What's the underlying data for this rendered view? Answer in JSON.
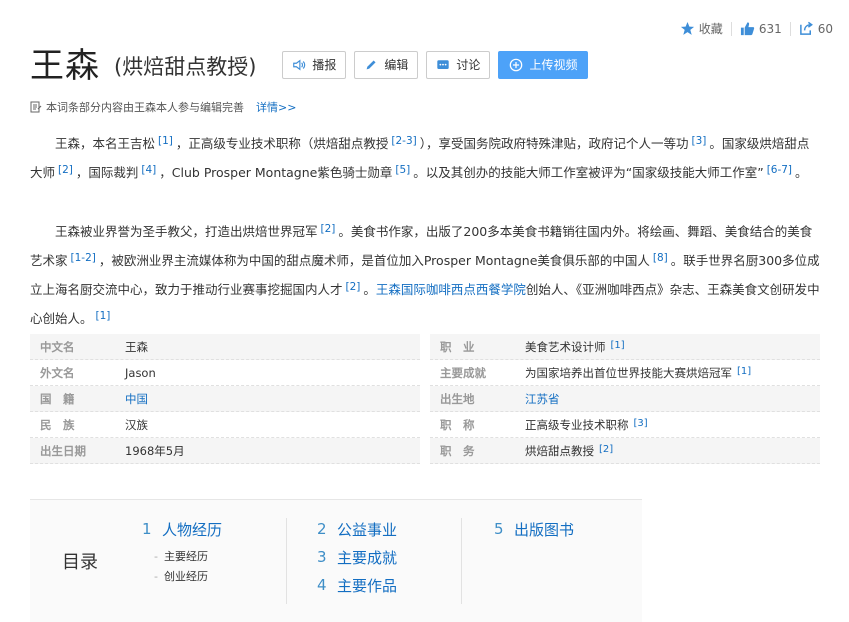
{
  "actions": {
    "favorite_label": "收藏",
    "like_count": "631",
    "share_count": "60"
  },
  "title": {
    "main": "王森",
    "sub": "(烘焙甜点教授)"
  },
  "buttons": {
    "broadcast": "播报",
    "edit": "编辑",
    "discuss": "讨论",
    "upload_video": "上传视频"
  },
  "notice": {
    "text": "本词条部分内容由王森本人参与编辑完善",
    "detail": "详情>>"
  },
  "summary": {
    "p1": [
      {
        "t": "王森，本名王吉松"
      },
      {
        "s": "[1]"
      },
      {
        "t": "，正高级专业技术职称（烘焙甜点教授"
      },
      {
        "s": "[2-3]"
      },
      {
        "t": "），享受国务院政府特殊津贴，政府记个人一等功"
      },
      {
        "s": "[3]"
      },
      {
        "t": "。国家级烘焙甜点大师"
      },
      {
        "s": "[2]"
      },
      {
        "t": "，国际裁判"
      },
      {
        "s": "[4]"
      },
      {
        "t": "，Club Prosper Montagne紫色骑士勋章"
      },
      {
        "s": "[5]"
      },
      {
        "t": "。以及其创办的技能大师工作室被评为“国家级技能大师工作室”"
      },
      {
        "s": "[6-7]"
      },
      {
        "t": "。"
      }
    ],
    "p2": [
      {
        "t": "王森被业界誉为圣手教父，打造出烘焙世界冠军"
      },
      {
        "s": "[2]"
      },
      {
        "t": "。美食书作家，出版了200多本美食书籍销往国内外。将绘画、舞蹈、美食结合的美食艺术家"
      },
      {
        "s": "[1-2]"
      },
      {
        "t": "，被欧洲业界主流媒体称为中国的甜点魔术师，是首位加入Prosper Montagne美食俱乐部的中国人"
      },
      {
        "s": "[8]"
      },
      {
        "t": "。联手世界名厨300多位成立上海名厨交流中心，致力于推动行业赛事挖掘国内人才"
      },
      {
        "s": "[2]"
      },
      {
        "t": "。"
      },
      {
        "l": "王森国际咖啡西点西餐学院"
      },
      {
        "t": "创始人、《亚洲咖啡西点》杂志、王森美食文创研发中心创始人。"
      },
      {
        "s": "[1]"
      }
    ]
  },
  "basic_info": {
    "left": [
      {
        "k": "中文名",
        "v": "王森"
      },
      {
        "k": "外文名",
        "v": "Jason"
      },
      {
        "k": "国　籍",
        "v": "中国",
        "link": true
      },
      {
        "k": "民　族",
        "v": "汉族"
      },
      {
        "k": "出生日期",
        "v": "1968年5月"
      }
    ],
    "right": [
      {
        "k": "职　业",
        "v": "美食艺术设计师",
        "ref": "[1]"
      },
      {
        "k": "主要成就",
        "v": "为国家培养出首位世界技能大赛烘焙冠军",
        "ref": "[1]"
      },
      {
        "k": "出生地",
        "v": "江苏省",
        "link": true
      },
      {
        "k": "职　称",
        "v": "正高级专业技术职称",
        "ref": "[3]"
      },
      {
        "k": "职　务",
        "v": "烘焙甜点教授",
        "ref": "[2]"
      }
    ]
  },
  "toc": {
    "title": "目录",
    "s1_num": "1",
    "s1": "人物经历",
    "s1_sub1": "主要经历",
    "s1_sub2": "创业经历",
    "s2_num": "2",
    "s2": "公益事业",
    "s3_num": "3",
    "s3": "主要成就",
    "s4_num": "4",
    "s4": "主要作品",
    "s5_num": "5",
    "s5": "出版图书",
    "dash": "-"
  },
  "colors": {
    "link": "#136ec2",
    "primary_button": "#4da2f8",
    "row_shade": "#f5f5f5"
  }
}
